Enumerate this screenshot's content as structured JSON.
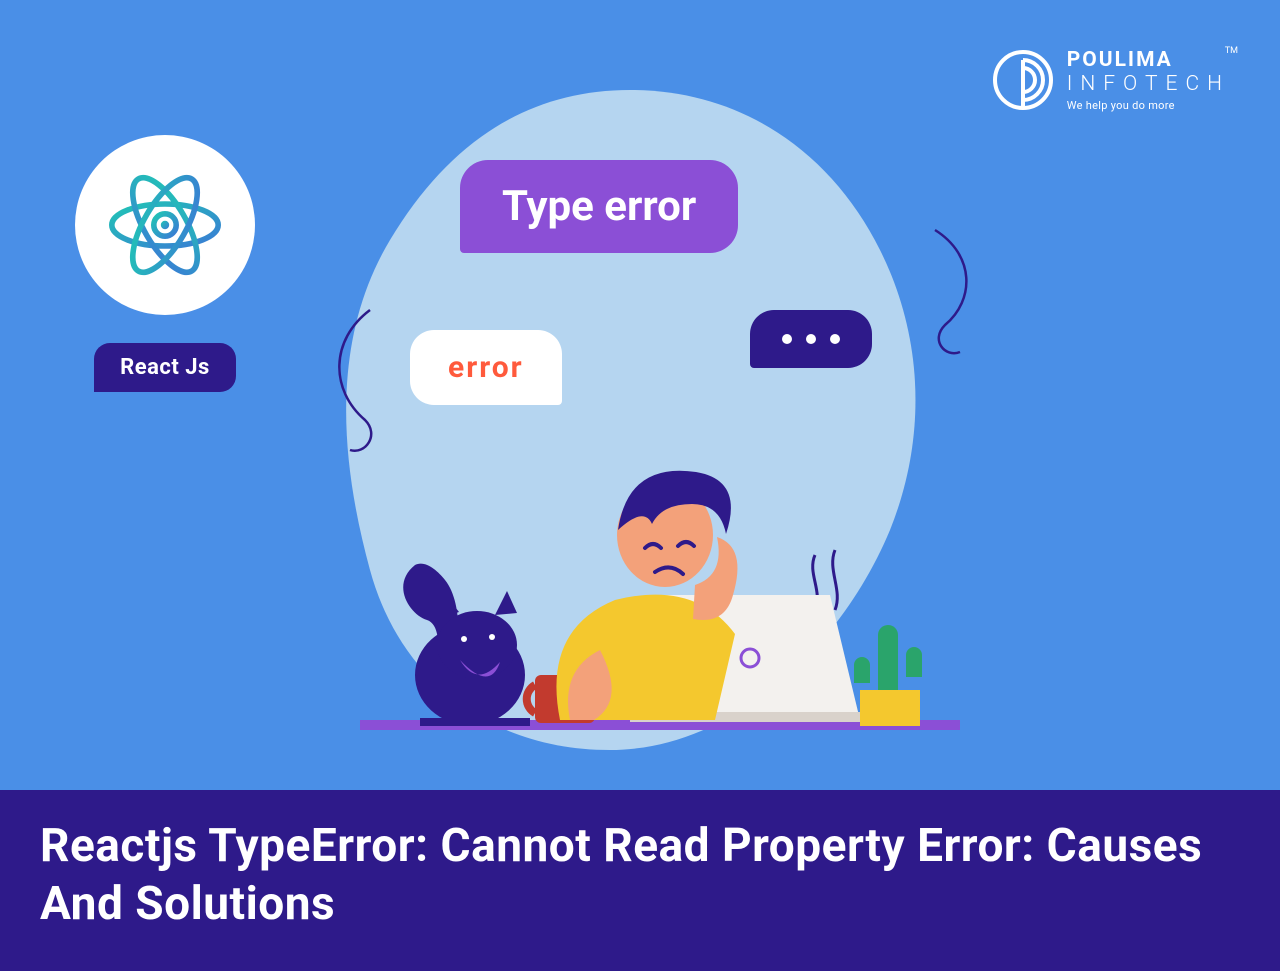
{
  "brand": {
    "line1": "POULIMA",
    "line2": "INFOTECH",
    "tagline": "We help you do more",
    "tm": "TM"
  },
  "react_badge": {
    "label": "React Js"
  },
  "bubbles": {
    "type_error": "Type error",
    "error": "error"
  },
  "title": "Reactjs TypeError: Cannot Read Property Error: Causes And Solutions",
  "colors": {
    "bg": "#4a8fe7",
    "dark_purple": "#2e1a8a",
    "light_purple": "#8b4fd6",
    "blob": "#b5d5f0",
    "orange": "#ff5a3c",
    "yellow": "#f4c82e",
    "teal": "#20c5b5"
  }
}
